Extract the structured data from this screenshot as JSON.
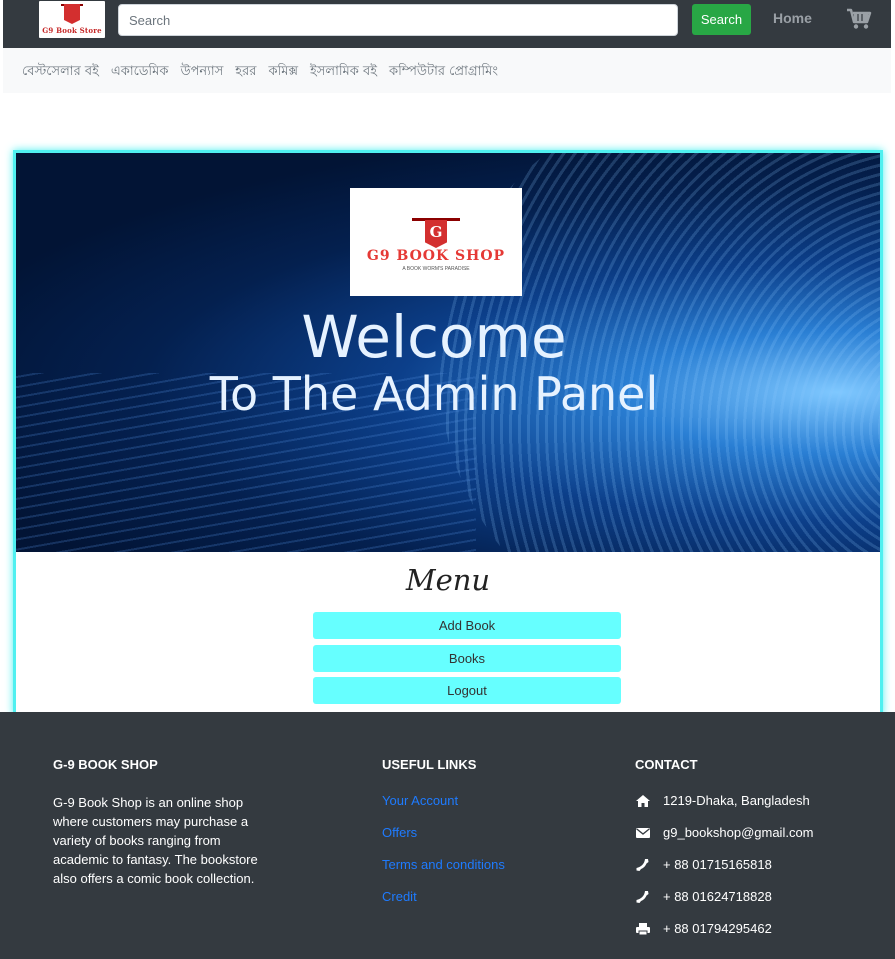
{
  "header": {
    "logo_text": "G9 Book Store",
    "search_placeholder": "Search",
    "search_button": "Search",
    "home_label": "Home",
    "cart_icon": "cart-icon"
  },
  "categories": [
    "বেস্টসেলার বই",
    "একাডেমিক",
    "উপন্যাস",
    "হরর",
    "কমিক্স",
    "ইসলামিক বই",
    "কম্পিউটার প্রোগ্রামিং"
  ],
  "banner": {
    "logo_g": "G",
    "logo_title": "G9 BOOK SHOP",
    "logo_tagline": "A BOOK WORM'S PARADISE",
    "welcome": "Welcome",
    "subtitle": "To The Admin Panel"
  },
  "menu": {
    "title": "Menu",
    "buttons": [
      "Add Book",
      "Books",
      "Logout"
    ]
  },
  "footer": {
    "about_title": "G-9 BOOK SHOP",
    "about_text": "G-9 Book Shop is an online shop where customers may purchase a variety of books ranging from academic to fantasy. The bookstore also offers a comic book collection.",
    "links_title": "USEFUL LINKS",
    "links": [
      "Your Account",
      "Offers",
      "Terms and conditions",
      "Credit"
    ],
    "contact_title": "CONTACT",
    "contact": [
      {
        "icon": "home-icon",
        "text": "1219-Dhaka, Bangladesh"
      },
      {
        "icon": "envelope-icon",
        "text": "g9_bookshop@gmail.com"
      },
      {
        "icon": "phone-icon",
        "text": "+ 88 01715165818"
      },
      {
        "icon": "phone-icon",
        "text": "+ 88 01624718828"
      },
      {
        "icon": "print-icon",
        "text": "+ 88 01794295462"
      }
    ]
  },
  "colors": {
    "navbar": "#343a40",
    "search_button": "#28a745",
    "menu_button": "#66ffff",
    "panel_border": "#4ff0f0",
    "link": "#1e7bff"
  }
}
